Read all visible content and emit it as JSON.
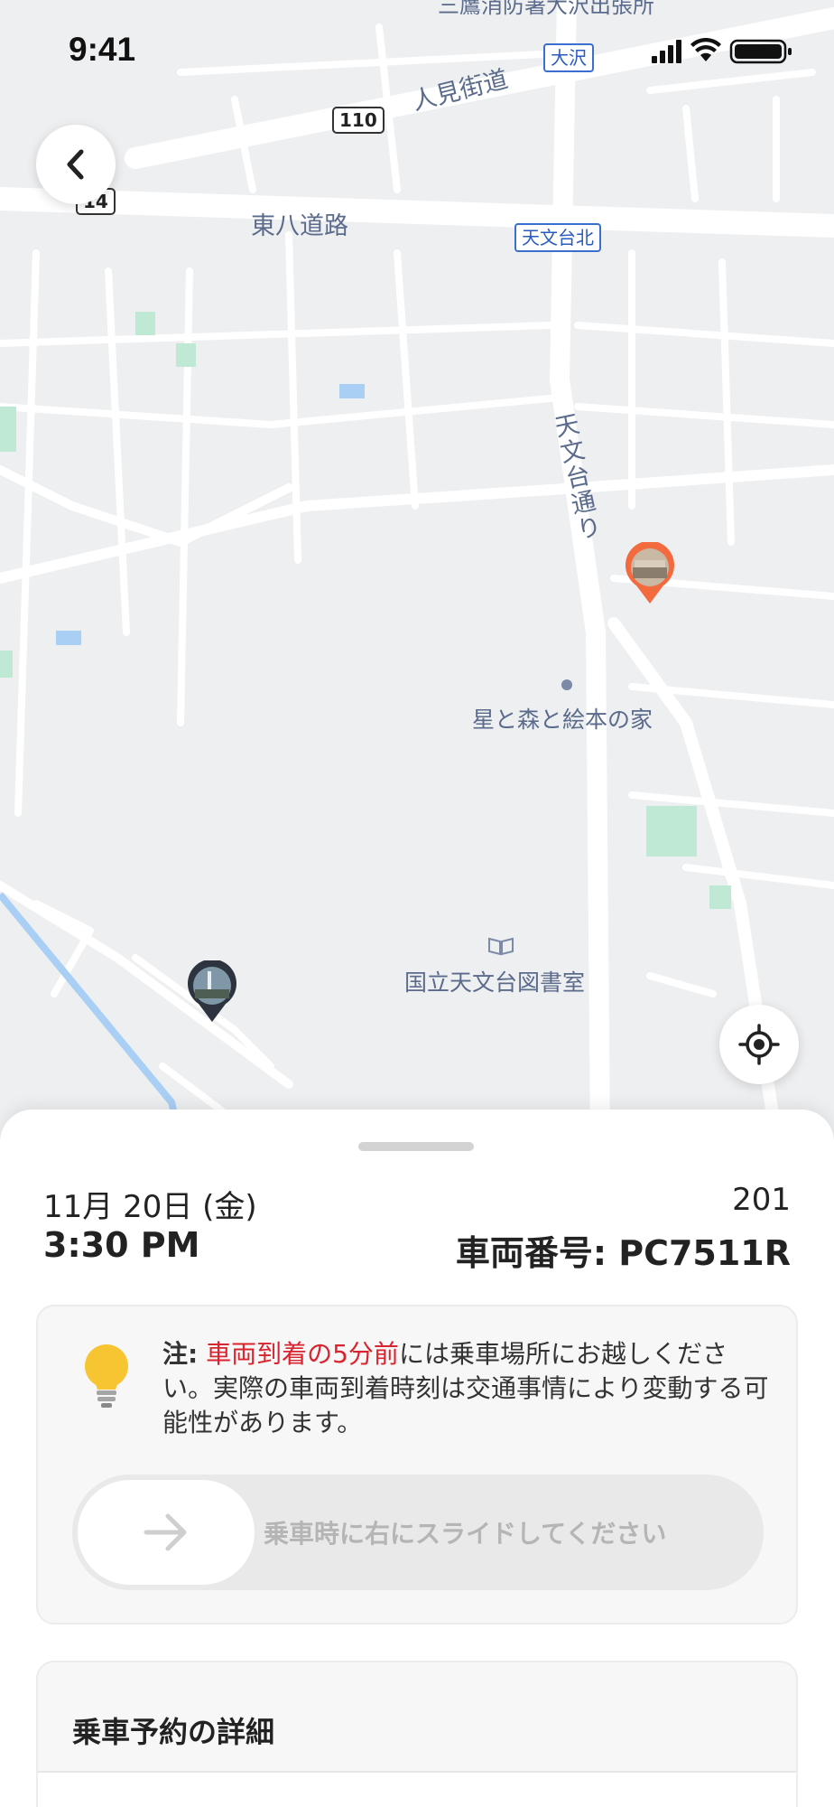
{
  "status_bar": {
    "time": "9:41"
  },
  "map": {
    "labels": {
      "top": "三鷹消防署大沢出張所",
      "hitomi": "人見街道",
      "tohachi": "東八道路",
      "tenmondai_dori": "天文台通り",
      "hoshi": "星と森と絵本の家",
      "library": "国立天文台図書室"
    },
    "route_numbers": {
      "r110": "110",
      "r14": "14"
    },
    "signs": {
      "osawa": "大沢",
      "tenmondai_kita": "天文台北"
    },
    "colors": {
      "background": "#eeeff1",
      "road": "#ffffff",
      "water": "#a9cff5",
      "park": "#bfe9d4",
      "accent_pin": "#f26a3d"
    }
  },
  "sheet": {
    "date": "11月 20日 (金)",
    "time": "3:30 PM",
    "trip_number": "201",
    "vehicle": "車両番号: PC7511R",
    "notice": {
      "prefix": "注:",
      "highlight": "車両到着の5分前",
      "rest": "には乗車場所にお越しください。実際の車両到着時刻は交通事情により変動する可能性があります。"
    },
    "slider_label": "乗車時に右にスライドしてください",
    "details_title": "乗車予約の詳細"
  },
  "icons": {
    "back": "chevron-left-icon",
    "locate": "crosshair-icon",
    "bulb": "lightbulb-icon",
    "slider": "arrow-right-icon"
  }
}
